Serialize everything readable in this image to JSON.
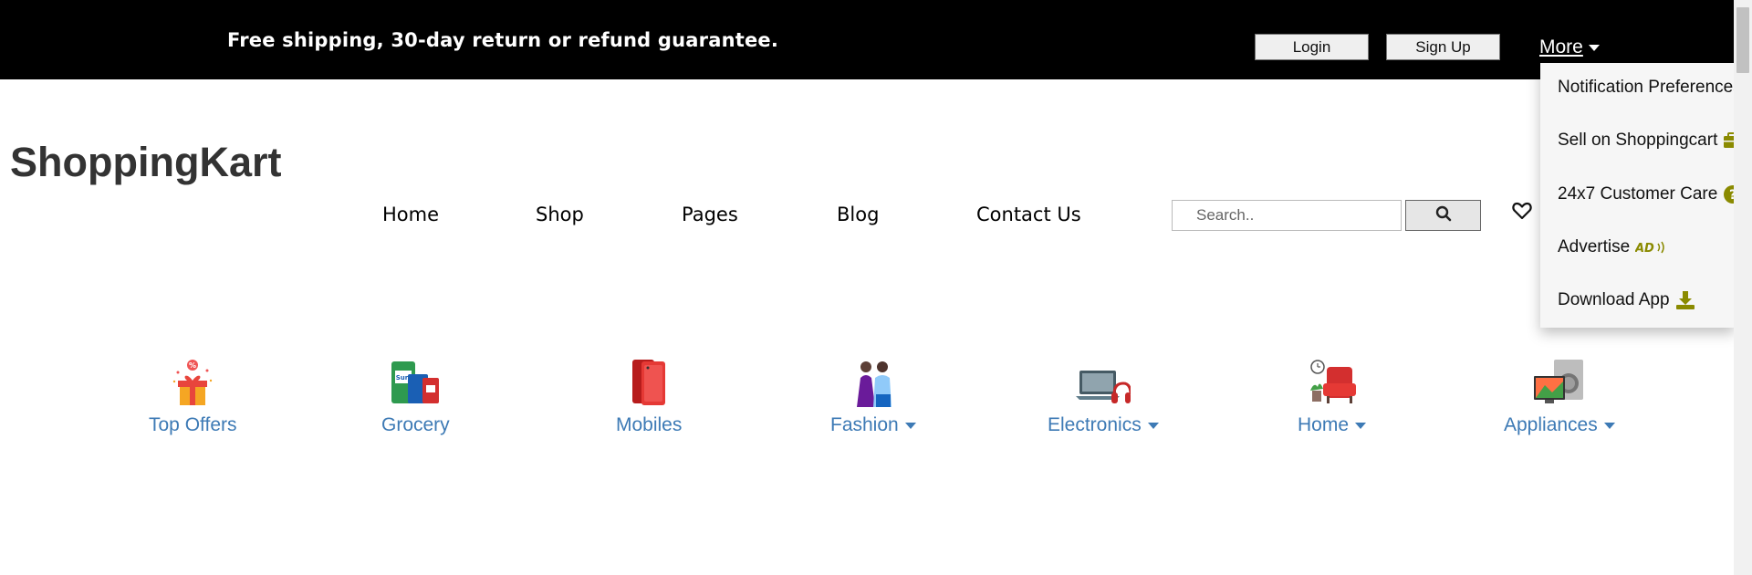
{
  "topbar": {
    "promo": "Free shipping, 30-day return or refund guarantee.",
    "login_label": "Login",
    "signup_label": "Sign Up",
    "more_label": "More"
  },
  "dropdown": {
    "items": [
      {
        "label": "Notification Preferences",
        "icon": "bell-icon"
      },
      {
        "label": "Sell on Shoppingcart",
        "icon": "briefcase-icon"
      },
      {
        "label": "24x7 Customer Care",
        "icon": "question-circle-icon"
      },
      {
        "label": "Advertise",
        "icon": "ad-icon"
      },
      {
        "label": "Download App",
        "icon": "download-icon"
      }
    ]
  },
  "brand": "ShoppingKart",
  "nav": {
    "items": [
      "Home",
      "Shop",
      "Pages",
      "Blog",
      "Contact Us"
    ]
  },
  "search": {
    "placeholder": "Search.."
  },
  "categories": [
    {
      "label": "Top Offers",
      "image": "gift-offers-image",
      "has_dropdown": false
    },
    {
      "label": "Grocery",
      "image": "grocery-image",
      "has_dropdown": false
    },
    {
      "label": "Mobiles",
      "image": "mobile-phone-image",
      "has_dropdown": false
    },
    {
      "label": "Fashion",
      "image": "fashion-couple-image",
      "has_dropdown": true
    },
    {
      "label": "Electronics",
      "image": "laptop-headphones-image",
      "has_dropdown": true
    },
    {
      "label": "Home",
      "image": "home-furniture-image",
      "has_dropdown": true
    },
    {
      "label": "Appliances",
      "image": "appliances-image",
      "has_dropdown": true
    }
  ],
  "colors": {
    "topbar_bg": "#000000",
    "category_link": "#3d7ab5",
    "dropdown_icon": "#8a8a00",
    "brand_text": "#333333"
  }
}
